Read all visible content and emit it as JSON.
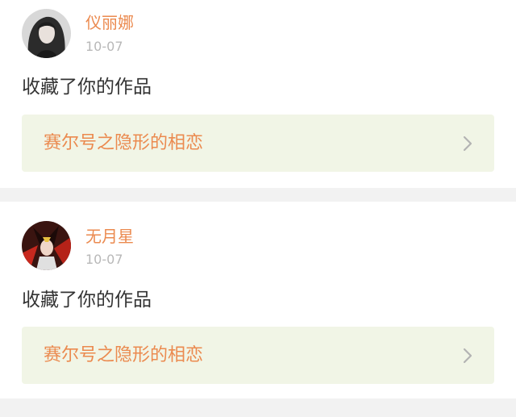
{
  "colors": {
    "accent": "#eb8a4f",
    "link_background": "#f1f5e6",
    "chevron": "#b3b3b3"
  },
  "notifications": [
    {
      "avatar_icon": "user-avatar-dark-hair",
      "username": "仪丽娜",
      "time": "10-07",
      "message": "收藏了你的作品",
      "work_title": "赛尔号之隐形的相恋",
      "chevron_icon": "chevron-right-icon"
    },
    {
      "avatar_icon": "user-avatar-anime-red",
      "username": "无月星",
      "time": "10-07",
      "message": "收藏了你的作品",
      "work_title": "赛尔号之隐形的相恋",
      "chevron_icon": "chevron-right-icon"
    }
  ]
}
